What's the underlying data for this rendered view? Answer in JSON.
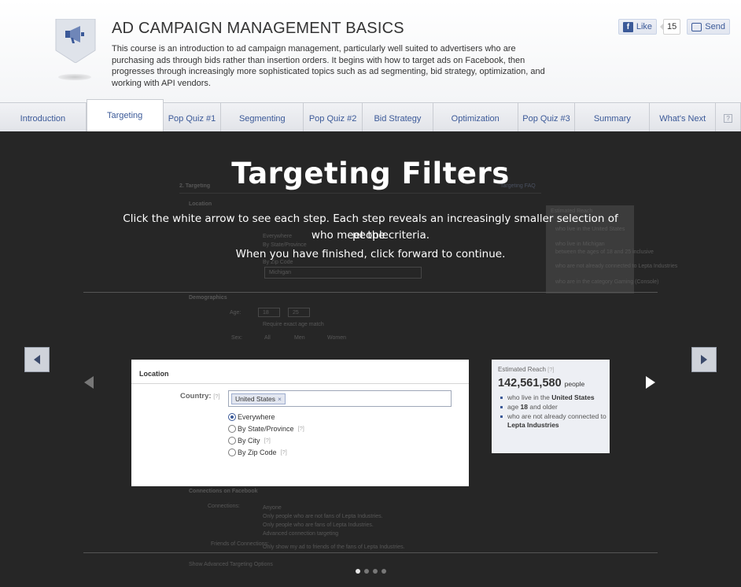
{
  "header": {
    "title": "AD CAMPAIGN MANAGEMENT BASICS",
    "description": "This course is an introduction to ad campaign management, particularly well suited to advertisers who are purchasing ads through bids rather than insertion orders. It begins with how to target ads on Facebook, then progresses through increasingly more sophisticated topics such as ad segmenting, bid strategy, optimization, and working with API vendors.",
    "badge_icon": "megaphone-icon"
  },
  "social": {
    "like_label": "Like",
    "like_count": "15",
    "send_label": "Send"
  },
  "tabs": [
    {
      "label": "Introduction"
    },
    {
      "label": "Targeting"
    },
    {
      "label": "Pop Quiz #1"
    },
    {
      "label": "Segmenting"
    },
    {
      "label": "Pop Quiz #2"
    },
    {
      "label": "Bid Strategy"
    },
    {
      "label": "Optimization"
    },
    {
      "label": "Pop Quiz #3"
    },
    {
      "label": "Summary"
    },
    {
      "label": "What's Next"
    }
  ],
  "active_tab": "Targeting",
  "help_label": "?",
  "stage": {
    "title": "Targeting Filters",
    "instruction_line1": "Click the white arrow to see each step. Each step reveals an increasingly smaller selection of people",
    "instruction_line2": "who meet the criteria.",
    "instruction_line3": "When you have finished, click forward to continue."
  },
  "location_panel": {
    "heading": "Location",
    "country_label": "Country:",
    "qmark": "[?]",
    "country_token": "United States",
    "token_remove": "×",
    "options": [
      {
        "label": "Everywhere",
        "selected": true,
        "help": ""
      },
      {
        "label": "By State/Province",
        "selected": false,
        "help": "[?]"
      },
      {
        "label": "By City",
        "selected": false,
        "help": "[?]"
      },
      {
        "label": "By Zip Code",
        "selected": false,
        "help": "[?]"
      }
    ]
  },
  "reach_panel": {
    "label": "Estimated Reach",
    "qmark": "[?]",
    "number": "142,561,580",
    "unit": "people",
    "item1_pre": "who live in the ",
    "item1_bold": "United States",
    "item2_pre": "age ",
    "item2_bold": "18",
    "item2_post": " and older",
    "item3_pre": "who are not already connected to ",
    "item3_bold": "Lepta Industries"
  },
  "background_form": {
    "section": "2. Targeting",
    "faq": "Targeting FAQ",
    "location": "Location",
    "everywhere": "Everywhere",
    "by_state": "By State/Province",
    "by_zip": "By Zip Code",
    "state_value": "Michigan",
    "demographics": "Demographics",
    "age": "Age:",
    "age_min": "18",
    "age_max": "25",
    "exact_age": "Require exact age match",
    "sex": "Sex:",
    "sex_all": "All",
    "sex_men": "Men",
    "sex_women": "Women",
    "connections": "Connections on Facebook",
    "connections_label": "Connections:",
    "anyone": "Anyone",
    "not_fans": "Only people who are not fans of Lepta Industries.",
    "fans": "Only people who are fans of Lepta Industries.",
    "advanced": "Advanced connection targeting",
    "friends_label": "Friends of Connections:",
    "friends_opt": "Only show my ad to friends of the fans of Lepta Industries.",
    "show_advanced": "Show Advanced Targeting Options",
    "reach_head": "Estimated Reach",
    "reach_1": "who live in the United States",
    "reach_2": "who live in Michigan",
    "reach_3": "between the ages of 18 and 25 inclusive",
    "reach_4": "who are not already connected to Lepta Industries",
    "reach_5": "who are in the category Gaming (Console)"
  },
  "pagination": {
    "total": 4,
    "current": 1
  },
  "colors": {
    "facebook_blue": "#3b5998",
    "stage_bg": "#262626",
    "tab_bg": "#e6e8ec",
    "reach_bg": "#edeff4"
  }
}
